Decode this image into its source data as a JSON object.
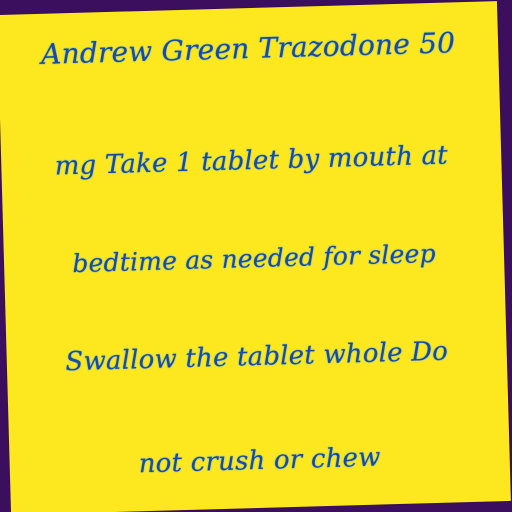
{
  "note": {
    "lines": [
      "Andrew Green Trazodone 50",
      "mg Take 1 tablet by mouth at",
      "bedtime as needed for sleep",
      "Swallow the tablet whole Do",
      "not crush or chew"
    ]
  },
  "colors": {
    "background": "#3b0f5e",
    "note": "#fde81f",
    "ink": "#1a4aa3"
  }
}
